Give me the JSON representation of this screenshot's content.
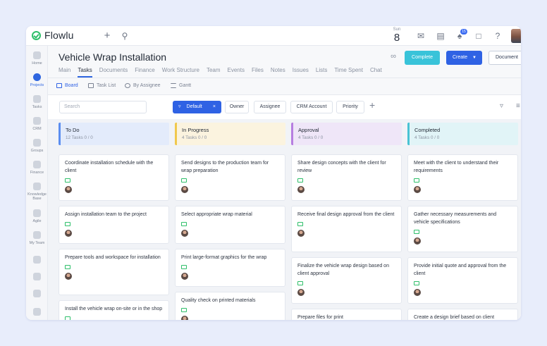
{
  "app": {
    "name": "Flowlu"
  },
  "topbar": {
    "date_dow": "Sun",
    "date_day": "8",
    "notifications_count": "15"
  },
  "sidebar": {
    "items": [
      {
        "label": "Home",
        "icon": "home-icon"
      },
      {
        "label": "Projects",
        "icon": "projects-icon"
      },
      {
        "label": "Tasks",
        "icon": "tasks-icon"
      },
      {
        "label": "CRM",
        "icon": "crm-icon"
      },
      {
        "label": "Groups",
        "icon": "groups-icon"
      },
      {
        "label": "Finance",
        "icon": "finance-icon"
      },
      {
        "label": "Knowledge Base",
        "icon": "knowledge-base-icon"
      },
      {
        "label": "Agile",
        "icon": "agile-icon"
      },
      {
        "label": "My Team",
        "icon": "my-team-icon"
      },
      {
        "label": "",
        "icon": "extra-icon-1"
      },
      {
        "label": "",
        "icon": "extra-icon-2"
      },
      {
        "label": "",
        "icon": "extra-icon-3"
      },
      {
        "label": "",
        "icon": "extra-icon-4"
      }
    ]
  },
  "project": {
    "title": "Vehicle Wrap Installation",
    "tabs": [
      "Main",
      "Tasks",
      "Documents",
      "Finance",
      "Work Structure",
      "Team",
      "Events",
      "Files",
      "Notes",
      "Issues",
      "Lists",
      "Time Spent",
      "Chat"
    ],
    "active_tab": "Tasks",
    "complete_label": "Complete",
    "create_label": "Create",
    "document_label": "Document"
  },
  "views": {
    "board": "Board",
    "task_list": "Task List",
    "by_assignee": "By Assignee",
    "gantt": "Gantt"
  },
  "filters": {
    "search_placeholder": "Search",
    "default_label": "Default",
    "chips": [
      "Owner",
      "Assignee",
      "CRM Account",
      "Priority"
    ]
  },
  "columns": [
    {
      "title": "To Do",
      "count": "12 Tasks  0 / 0",
      "color": "#5b8ef0",
      "bg": "#e3ebfb",
      "cards": [
        "Coordinate installation schedule with the client",
        "Assign installation team to the project",
        "Prepare tools and workspace for installation",
        "Install the vehicle wrap on-site or in the shop"
      ]
    },
    {
      "title": "In Progress",
      "count": "4 Tasks  0 / 0",
      "color": "#f0c84d",
      "bg": "#fbf3df",
      "cards": [
        "Send designs to the production team for wrap preparation",
        "Select appropriate wrap material",
        "Print large-format graphics for the wrap",
        "Quality check on printed materials"
      ]
    },
    {
      "title": "Approval",
      "count": "4 Tasks  0 / 0",
      "color": "#b77ee0",
      "bg": "#efe6f8",
      "cards": [
        "Share design concepts with the client for review",
        "Receive final design approval from the client",
        "Finalize the vehicle wrap design based on client approval",
        "Prepare files for print"
      ]
    },
    {
      "title": "Completed",
      "count": "4 Tasks  0 / 0",
      "color": "#49c3d4",
      "bg": "#e1f4f7",
      "cards": [
        "Meet with the client to understand their requirements",
        "Gather necessary measurements and vehicle specifications",
        "Provide initial quote and approval from the client",
        "Create a design brief based on client feedback"
      ]
    }
  ]
}
